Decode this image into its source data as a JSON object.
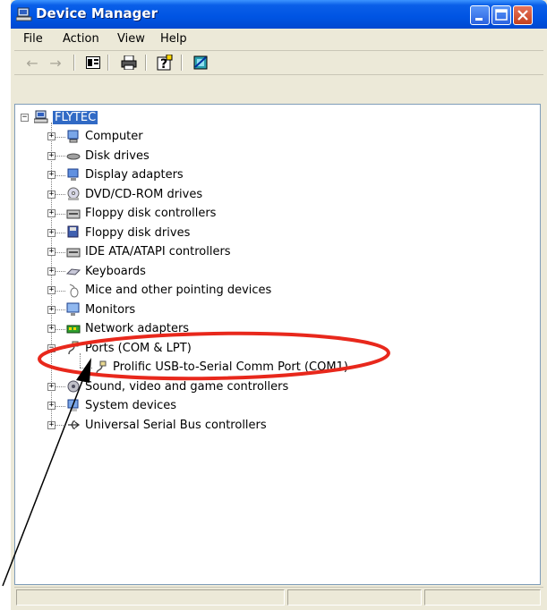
{
  "window": {
    "title": "Device Manager",
    "titlebar_color": "#0054e3"
  },
  "menu": {
    "file": "File",
    "action": "Action",
    "view": "View",
    "help": "Help"
  },
  "toolbar": {
    "back_icon": "back-arrow-icon",
    "forward_icon": "forward-arrow-icon",
    "properties_icon": "properties-icon",
    "print_icon": "print-icon",
    "help_icon": "help-icon",
    "scan_icon": "scan-hardware-icon"
  },
  "tree": {
    "root": "FLYTEC",
    "items": [
      {
        "label": "Computer",
        "icon": "computer-icon"
      },
      {
        "label": "Disk drives",
        "icon": "disk-drive-icon"
      },
      {
        "label": "Display adapters",
        "icon": "display-icon"
      },
      {
        "label": "DVD/CD-ROM drives",
        "icon": "cd-icon"
      },
      {
        "label": "Floppy disk controllers",
        "icon": "controller-icon"
      },
      {
        "label": "Floppy disk drives",
        "icon": "floppy-icon"
      },
      {
        "label": "IDE ATA/ATAPI controllers",
        "icon": "controller-icon"
      },
      {
        "label": "Keyboards",
        "icon": "keyboard-icon"
      },
      {
        "label": "Mice and other pointing devices",
        "icon": "mouse-icon"
      },
      {
        "label": "Monitors",
        "icon": "monitor-icon"
      },
      {
        "label": "Network adapters",
        "icon": "network-icon"
      },
      {
        "label": "Ports (COM & LPT)",
        "icon": "port-icon"
      },
      {
        "label": "Prolific USB-to-Serial Comm Port (COM1)",
        "icon": "port-icon"
      },
      {
        "label": "Sound, video and game controllers",
        "icon": "sound-icon"
      },
      {
        "label": "System devices",
        "icon": "system-icon"
      },
      {
        "label": "Universal Serial Bus controllers",
        "icon": "usb-icon"
      }
    ]
  },
  "annotation": {
    "highlight_color": "#e8281c",
    "arrow_color": "#000000"
  }
}
